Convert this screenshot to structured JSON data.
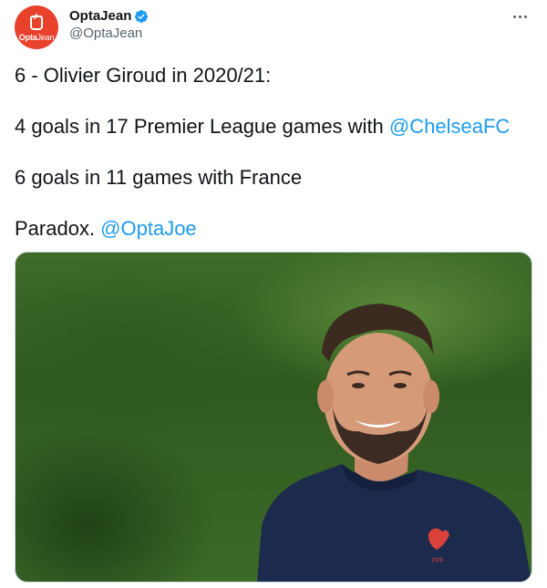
{
  "account": {
    "display_name": "OptaJean",
    "handle": "@OptaJean",
    "avatar_text": "Opta",
    "avatar_text_light": "Jean",
    "verified_icon": "verified-badge-icon",
    "brand_color": "#e8412c",
    "verified_color": "#1d9bf0"
  },
  "menu": {
    "icon": "more-horizontal-icon"
  },
  "tweet": {
    "line1": "6 - Olivier Giroud in 2020/21:",
    "line2_text": "4 goals in 17 Premier League games with ",
    "line2_mention": "@ChelseaFC",
    "line3": "6 goals in 11 games with France",
    "line4_text": "Paradox. ",
    "line4_mention": "@OptaJoe",
    "mention_color": "#1d9bf0"
  },
  "media": {
    "type": "photo",
    "description_icon": "player-photo-image"
  }
}
